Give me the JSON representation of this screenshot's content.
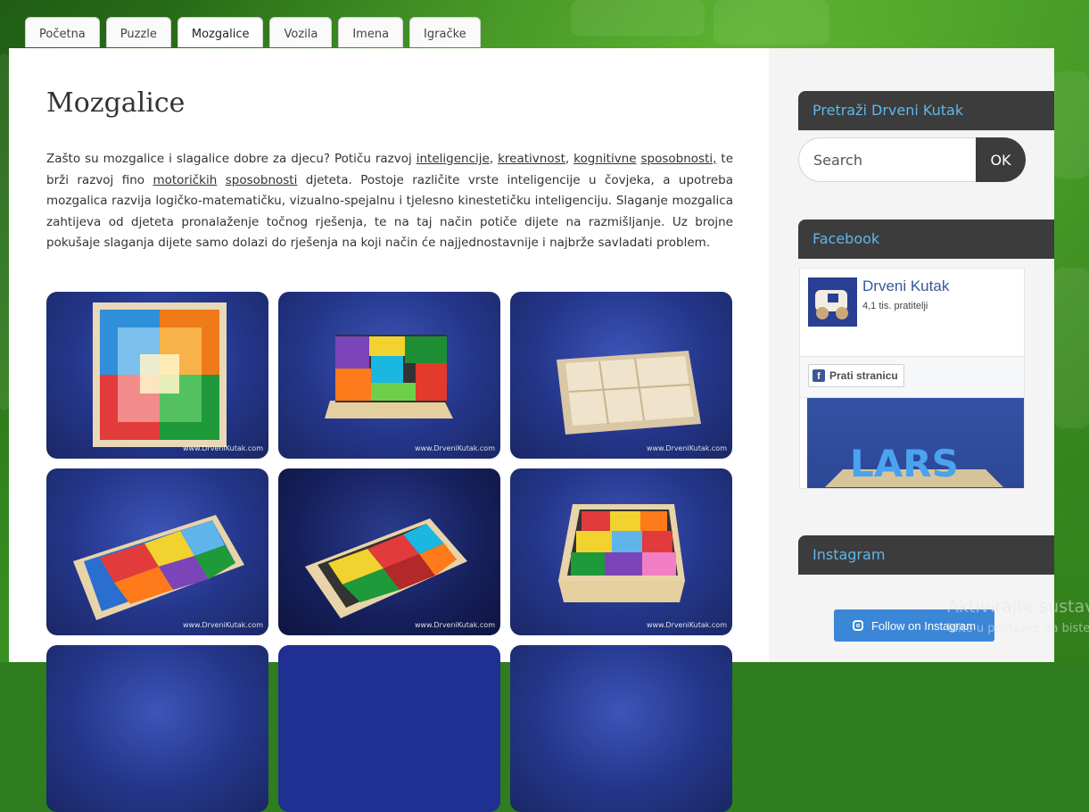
{
  "tabs": [
    {
      "label": "Početna"
    },
    {
      "label": "Puzzle"
    },
    {
      "label": "Mozgalice"
    },
    {
      "label": "Vozila"
    },
    {
      "label": "Imena"
    },
    {
      "label": "Igračke"
    }
  ],
  "main": {
    "title": "Mozgalice",
    "intro": {
      "p1": "Zašto su mozgalice i slagalice dobre za djecu? Potiču razvoj ",
      "link_inteligencije": "inteligencije",
      "sep1": ", ",
      "link_kreativnost": "kreativnost",
      "sep2": ", ",
      "link_kognitivne": "kognitivne",
      "sep3": " ",
      "link_sposobnosti1": "sposobnosti,",
      "p2": " te brži razvoj fino ",
      "link_motorickih": "motoričkih",
      "sep4": " ",
      "link_sposobnosti2": "sposobnosti",
      "p3": " djeteta. Postoje različite vrste inteligencije u čovjeka, a upotreba mozgalica razvija logičko-matematičku, vizualno-spejalnu i tjelesno kinestetičku inteligenciju. Slaganje mozgalica zahtijeva od djeteta pronalaženje točnog rješenja, te na taj način potiče dijete na razmišljanje. Uz brojne pokušaje slaganja dijete samo dolazi do rješenja na koji način će najjednostavnije i najbrže savladati problem."
    },
    "gallery_watermark": "www.DrveniKutak.com"
  },
  "sidebar": {
    "search_title": "Pretraži Drveni Kutak",
    "search_placeholder": "Search",
    "search_button": "OK",
    "facebook_title": "Facebook",
    "fb_page_name": "Drveni Kutak",
    "fb_followers": "4,1 tis. pratitelji",
    "fb_follow_button": "Prati stranicu",
    "fb_cover_text": "LARS",
    "instagram_title": "Instagram",
    "instagram_button": "Follow on Instagram"
  },
  "overlay": {
    "activate_title": "Aktivirajte sustav",
    "activate_sub": "Idite u postavke da biste"
  },
  "colors": {
    "accent_blue": "#5fb6ec",
    "widget_header": "#3c3c3c",
    "instagram_button": "#3b86d6",
    "page_background": "#2f7d1e"
  }
}
